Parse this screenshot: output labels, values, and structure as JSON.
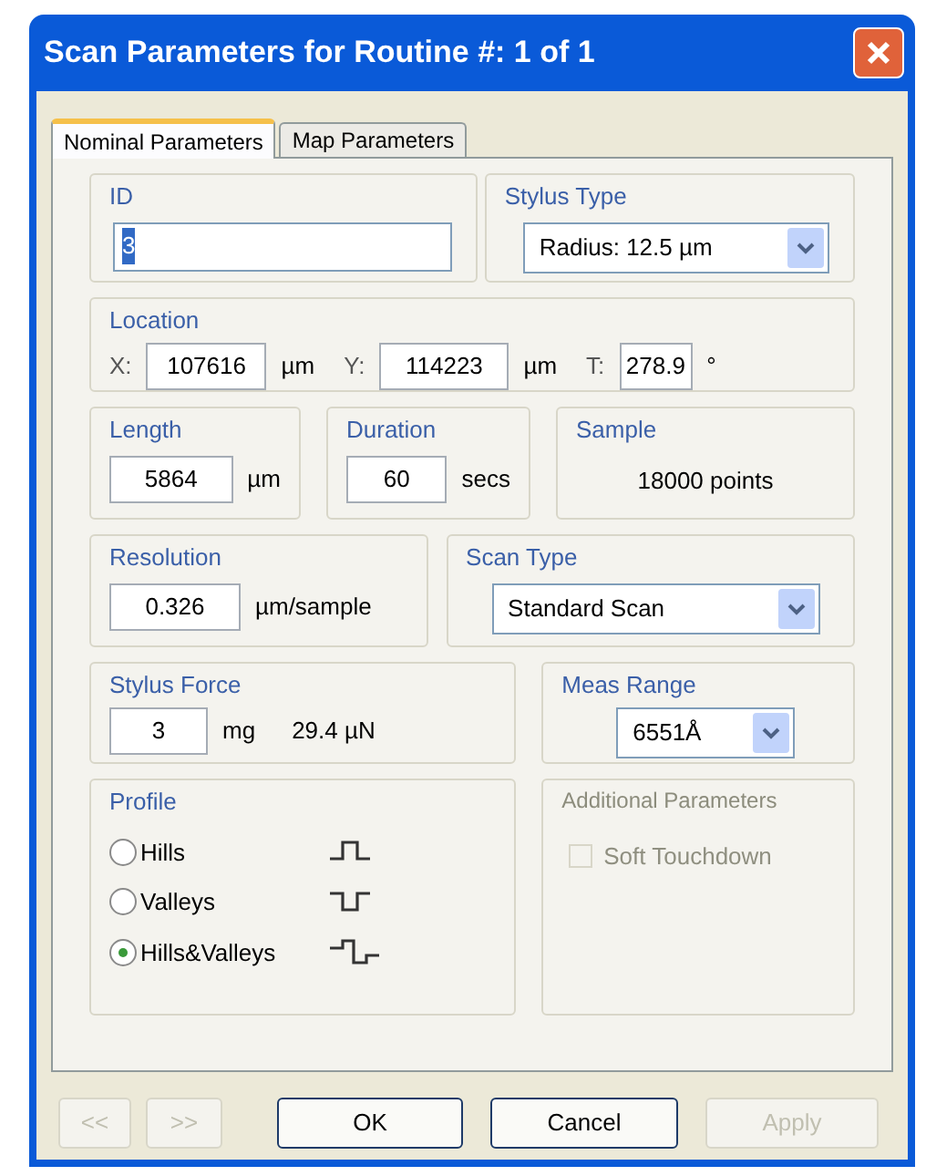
{
  "window": {
    "title": "Scan Parameters for Routine #: 1 of 1"
  },
  "tabs": [
    {
      "label": "Nominal Parameters",
      "selected": true
    },
    {
      "label": "Map Parameters",
      "selected": false
    }
  ],
  "id": {
    "label": "ID",
    "value": "3",
    "text_selected": true
  },
  "stylus_type": {
    "label": "Stylus Type",
    "value": "Radius: 12.5 µm"
  },
  "location": {
    "label": "Location",
    "fields": [
      {
        "prefix": "X:",
        "value": "107616",
        "unit": "µm"
      },
      {
        "prefix": "Y:",
        "value": "114223",
        "unit": "µm"
      },
      {
        "prefix": "T:",
        "value": "278.9",
        "unit": "°"
      }
    ]
  },
  "length": {
    "label": "Length",
    "value": "5864",
    "unit": "µm"
  },
  "duration": {
    "label": "Duration",
    "value": "60",
    "unit": "secs"
  },
  "sample": {
    "label": "Sample",
    "value": "18000 points"
  },
  "resolution": {
    "label": "Resolution",
    "value": "0.326",
    "unit": "µm/sample"
  },
  "scan_type": {
    "label": "Scan Type",
    "value": "Standard Scan"
  },
  "stylus_force": {
    "label": "Stylus Force",
    "value": "3",
    "unit": "mg",
    "reading": "29.4 µN"
  },
  "meas_range": {
    "label": "Meas Range",
    "value": "6551Å"
  },
  "profile": {
    "label": "Profile",
    "options": [
      {
        "label": "Hills",
        "kind": "hills",
        "selected": false
      },
      {
        "label": "Valleys",
        "kind": "valleys",
        "selected": false
      },
      {
        "label": "Hills&Valleys",
        "kind": "both",
        "selected": true
      }
    ]
  },
  "additional": {
    "label": "Additional Parameters",
    "disabled": true,
    "options": [
      {
        "label": "Soft Touchdown",
        "checked": false,
        "disabled": true
      }
    ]
  },
  "buttons": [
    {
      "label": "<<",
      "disabled": true
    },
    {
      "label": ">>",
      "disabled": true
    },
    {
      "label": "OK",
      "disabled": false
    },
    {
      "label": "Cancel",
      "disabled": false
    },
    {
      "label": "Apply",
      "disabled": true
    }
  ]
}
